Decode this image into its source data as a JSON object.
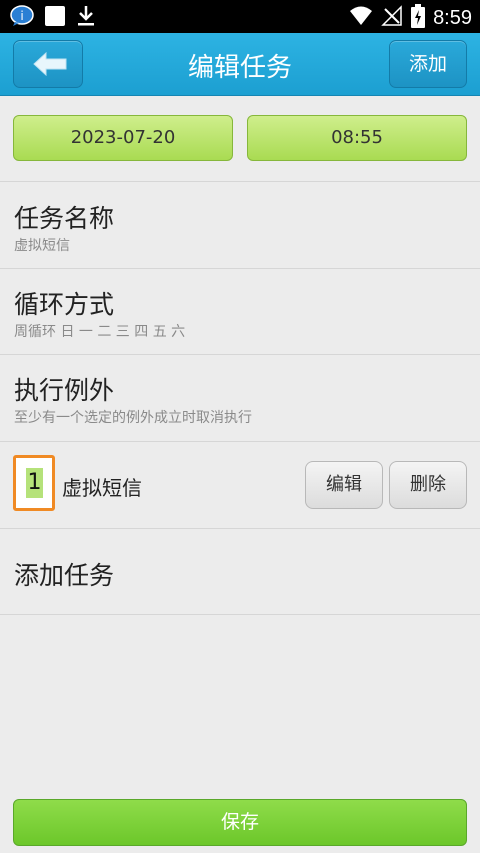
{
  "status_bar": {
    "time": "8:59",
    "icons": [
      "info-notification-icon",
      "blank-notification-icon",
      "download-icon",
      "wifi-icon",
      "no-signal-icon",
      "battery-charging-icon"
    ]
  },
  "header": {
    "title": "编辑任务",
    "add_label": "添加",
    "back_icon": "back-arrow-icon"
  },
  "schedule": {
    "date": "2023-07-20",
    "time": "08:55"
  },
  "rows": {
    "task_name": {
      "title": "任务名称",
      "subtitle": "虚拟短信"
    },
    "repeat": {
      "title": "循环方式",
      "subtitle": "周循环 日 一 二 三 四 五 六"
    },
    "exceptions": {
      "title": "执行例外",
      "subtitle": "至少有一个选定的例外成立时取消执行"
    }
  },
  "tasks": [
    {
      "index": "1",
      "name": "虚拟短信",
      "edit_label": "编辑",
      "delete_label": "删除"
    }
  ],
  "add_task_label": "添加任务",
  "save_label": "保存",
  "colors": {
    "header": "#1fa6d8",
    "green_button": "#b9e46c",
    "save_button": "#7ad03a",
    "index_border": "#f08a24"
  }
}
